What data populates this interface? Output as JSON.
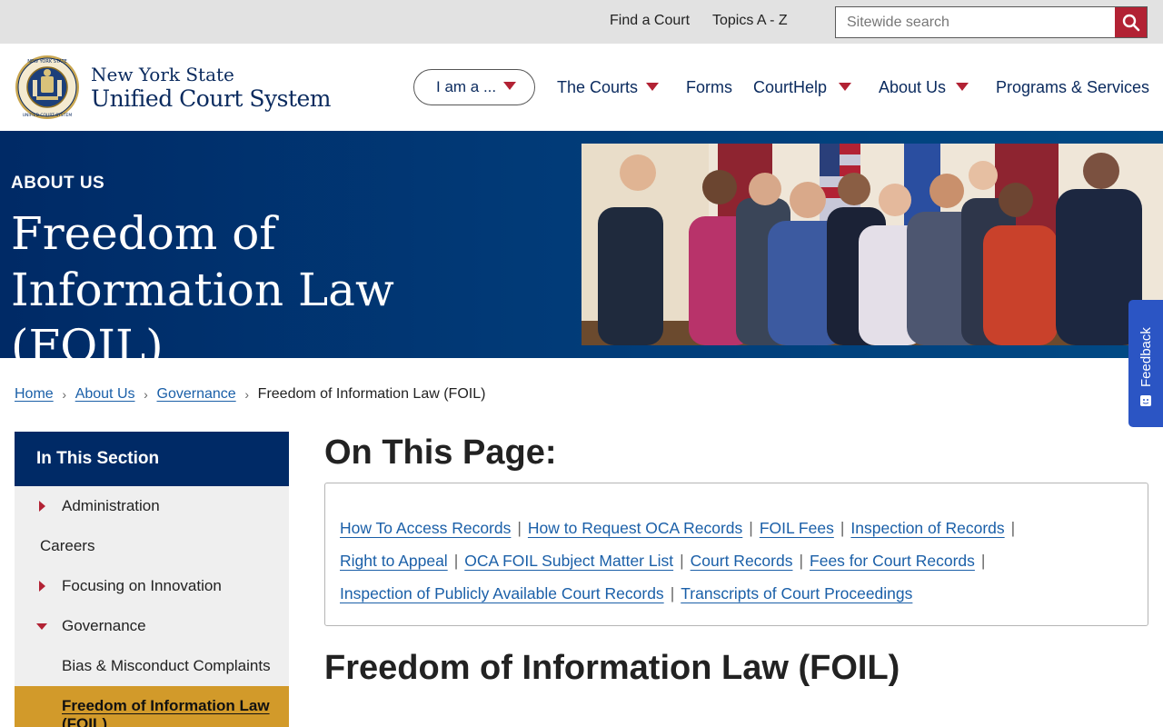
{
  "utility_nav": {
    "links": [
      "Find a Court",
      "Topics A - Z"
    ],
    "search": {
      "placeholder": "Sitewide search"
    }
  },
  "header": {
    "logo_line1": "New York State",
    "logo_line2": "Unified Court System",
    "seal_ring_text": "NEW YORK STATE · UNIFIED COURT SYSTEM",
    "iam_label": "I am a ...",
    "nav": [
      "The Courts",
      "Forms",
      "CourtHelp",
      "About Us",
      "Programs & Services"
    ]
  },
  "banner": {
    "eyebrow": "ABOUT US",
    "title": "Freedom of Information Law (FOIL)"
  },
  "feedback": {
    "label": "Feedback"
  },
  "breadcrumb": {
    "items": [
      "Home",
      "About Us",
      "Governance"
    ],
    "current": "Freedom of Information Law (FOIL)"
  },
  "sidebar": {
    "header": "In This Section",
    "items": [
      "Administration",
      "Careers",
      "Focusing on Innovation",
      "Governance",
      "Bias & Misconduct Complaints",
      "Freedom of Information Law (FOIL)"
    ]
  },
  "on_this_page": {
    "heading": "On This Page:",
    "links": [
      "How To Access Records",
      "How to Request OCA Records",
      "FOIL Fees",
      "Inspection of Records",
      "Right to Appeal",
      "OCA FOIL Subject Matter List",
      "Court Records",
      "Fees for Court Records",
      "Inspection of Publicly Available Court Records",
      "Transcripts of Court Proceedings"
    ],
    "separator": "|"
  },
  "section_heading": "Freedom of Information Law (FOIL)",
  "colors": {
    "navy": "#002a66",
    "link": "#1a5fa8",
    "accent_red": "#b22234",
    "active_gold": "#d29a2a",
    "feedback_blue": "#2b55c4"
  }
}
